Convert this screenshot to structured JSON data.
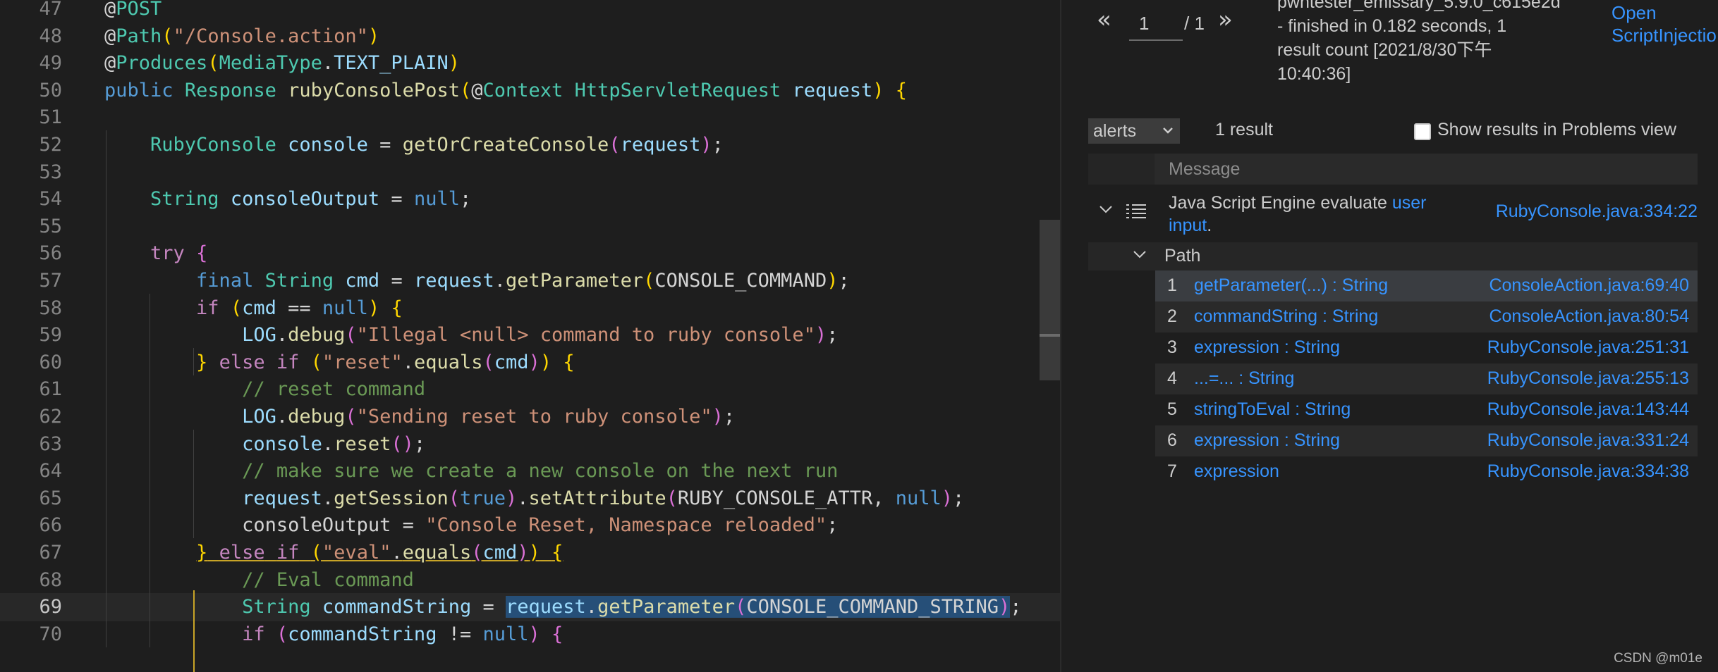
{
  "editor": {
    "current_line": 69,
    "lines": [
      {
        "n": "47",
        "tokens": [
          {
            "t": "@",
            "c": "at"
          },
          {
            "t": "POST",
            "c": "anno"
          }
        ]
      },
      {
        "n": "48",
        "tokens": [
          {
            "t": "@",
            "c": "at"
          },
          {
            "t": "Path",
            "c": "anno"
          },
          {
            "t": "(",
            "c": "bracket-y"
          },
          {
            "t": "\"/Console.action\"",
            "c": "string"
          },
          {
            "t": ")",
            "c": "bracket-y"
          }
        ]
      },
      {
        "n": "49",
        "tokens": [
          {
            "t": "@",
            "c": "at"
          },
          {
            "t": "Produces",
            "c": "anno"
          },
          {
            "t": "(",
            "c": "bracket-y"
          },
          {
            "t": "MediaType",
            "c": "type"
          },
          {
            "t": ".",
            "c": "plain"
          },
          {
            "t": "TEXT_PLAIN",
            "c": "const"
          },
          {
            "t": ")",
            "c": "bracket-y"
          }
        ]
      },
      {
        "n": "50",
        "indent": -1,
        "tokens": [
          {
            "t": "public",
            "c": "keyword"
          },
          {
            "t": " ",
            "c": "plain"
          },
          {
            "t": "Response",
            "c": "type"
          },
          {
            "t": " ",
            "c": "plain"
          },
          {
            "t": "rubyConsolePost",
            "c": "func"
          },
          {
            "t": "(",
            "c": "bracket-y"
          },
          {
            "t": "@",
            "c": "at"
          },
          {
            "t": "Context",
            "c": "anno"
          },
          {
            "t": " ",
            "c": "plain"
          },
          {
            "t": "HttpServletRequest",
            "c": "type"
          },
          {
            "t": " ",
            "c": "plain"
          },
          {
            "t": "request",
            "c": "var"
          },
          {
            "t": ")",
            "c": "bracket-y"
          },
          {
            "t": " ",
            "c": "plain"
          },
          {
            "t": "{",
            "c": "bracket-y"
          }
        ]
      },
      {
        "n": "51",
        "tokens": []
      },
      {
        "n": "52",
        "tokens": [
          {
            "t": "    ",
            "c": "plain"
          },
          {
            "t": "RubyConsole",
            "c": "type"
          },
          {
            "t": " ",
            "c": "plain"
          },
          {
            "t": "console",
            "c": "var"
          },
          {
            "t": " = ",
            "c": "plain"
          },
          {
            "t": "getOrCreateConsole",
            "c": "func"
          },
          {
            "t": "(",
            "c": "bracket-p"
          },
          {
            "t": "request",
            "c": "var"
          },
          {
            "t": ")",
            "c": "bracket-p"
          },
          {
            "t": ";",
            "c": "plain"
          }
        ]
      },
      {
        "n": "53",
        "tokens": []
      },
      {
        "n": "54",
        "tokens": [
          {
            "t": "    ",
            "c": "plain"
          },
          {
            "t": "String",
            "c": "type"
          },
          {
            "t": " ",
            "c": "plain"
          },
          {
            "t": "consoleOutput",
            "c": "var"
          },
          {
            "t": " = ",
            "c": "plain"
          },
          {
            "t": "null",
            "c": "keyword"
          },
          {
            "t": ";",
            "c": "plain"
          }
        ]
      },
      {
        "n": "55",
        "tokens": []
      },
      {
        "n": "56",
        "tokens": [
          {
            "t": "    ",
            "c": "plain"
          },
          {
            "t": "try",
            "c": "control"
          },
          {
            "t": " ",
            "c": "plain"
          },
          {
            "t": "{",
            "c": "bracket-p"
          }
        ]
      },
      {
        "n": "57",
        "tokens": [
          {
            "t": "        ",
            "c": "plain"
          },
          {
            "t": "final",
            "c": "keyword"
          },
          {
            "t": " ",
            "c": "plain"
          },
          {
            "t": "String",
            "c": "type"
          },
          {
            "t": " ",
            "c": "plain"
          },
          {
            "t": "cmd",
            "c": "var"
          },
          {
            "t": " = ",
            "c": "plain"
          },
          {
            "t": "request",
            "c": "var"
          },
          {
            "t": ".",
            "c": "plain"
          },
          {
            "t": "getParameter",
            "c": "func"
          },
          {
            "t": "(",
            "c": "bracket-y"
          },
          {
            "t": "CONSOLE_COMMAND",
            "c": "plain"
          },
          {
            "t": ")",
            "c": "bracket-y"
          },
          {
            "t": ";",
            "c": "plain"
          }
        ]
      },
      {
        "n": "58",
        "tokens": [
          {
            "t": "        ",
            "c": "plain"
          },
          {
            "t": "if",
            "c": "control"
          },
          {
            "t": " ",
            "c": "plain"
          },
          {
            "t": "(",
            "c": "bracket-y"
          },
          {
            "t": "cmd",
            "c": "var"
          },
          {
            "t": " == ",
            "c": "plain"
          },
          {
            "t": "null",
            "c": "keyword"
          },
          {
            "t": ")",
            "c": "bracket-y"
          },
          {
            "t": " ",
            "c": "plain"
          },
          {
            "t": "{",
            "c": "bracket-y"
          }
        ]
      },
      {
        "n": "59",
        "tokens": [
          {
            "t": "            ",
            "c": "plain"
          },
          {
            "t": "LOG",
            "c": "const"
          },
          {
            "t": ".",
            "c": "plain"
          },
          {
            "t": "debug",
            "c": "func"
          },
          {
            "t": "(",
            "c": "bracket-p"
          },
          {
            "t": "\"Illegal <null> command to ruby console\"",
            "c": "string"
          },
          {
            "t": ")",
            "c": "bracket-p"
          },
          {
            "t": ";",
            "c": "plain"
          }
        ]
      },
      {
        "n": "60",
        "tokens": [
          {
            "t": "        ",
            "c": "plain"
          },
          {
            "t": "}",
            "c": "bracket-y"
          },
          {
            "t": " ",
            "c": "plain"
          },
          {
            "t": "else",
            "c": "control"
          },
          {
            "t": " ",
            "c": "plain"
          },
          {
            "t": "if",
            "c": "control"
          },
          {
            "t": " ",
            "c": "plain"
          },
          {
            "t": "(",
            "c": "bracket-y"
          },
          {
            "t": "\"reset\"",
            "c": "string"
          },
          {
            "t": ".",
            "c": "plain"
          },
          {
            "t": "equals",
            "c": "func"
          },
          {
            "t": "(",
            "c": "bracket-p"
          },
          {
            "t": "cmd",
            "c": "var"
          },
          {
            "t": ")",
            "c": "bracket-p"
          },
          {
            "t": ")",
            "c": "bracket-y"
          },
          {
            "t": " ",
            "c": "plain"
          },
          {
            "t": "{",
            "c": "bracket-y"
          }
        ]
      },
      {
        "n": "61",
        "tokens": [
          {
            "t": "            ",
            "c": "plain"
          },
          {
            "t": "// reset command",
            "c": "comment"
          }
        ]
      },
      {
        "n": "62",
        "tokens": [
          {
            "t": "            ",
            "c": "plain"
          },
          {
            "t": "LOG",
            "c": "const"
          },
          {
            "t": ".",
            "c": "plain"
          },
          {
            "t": "debug",
            "c": "func"
          },
          {
            "t": "(",
            "c": "bracket-p"
          },
          {
            "t": "\"Sending reset to ruby console\"",
            "c": "string"
          },
          {
            "t": ")",
            "c": "bracket-p"
          },
          {
            "t": ";",
            "c": "plain"
          }
        ]
      },
      {
        "n": "63",
        "tokens": [
          {
            "t": "            ",
            "c": "plain"
          },
          {
            "t": "console",
            "c": "var"
          },
          {
            "t": ".",
            "c": "plain"
          },
          {
            "t": "reset",
            "c": "func"
          },
          {
            "t": "()",
            "c": "bracket-p"
          },
          {
            "t": ";",
            "c": "plain"
          }
        ]
      },
      {
        "n": "64",
        "tokens": [
          {
            "t": "            ",
            "c": "plain"
          },
          {
            "t": "// make sure we create a new console on the next run",
            "c": "comment"
          }
        ]
      },
      {
        "n": "65",
        "tokens": [
          {
            "t": "            ",
            "c": "plain"
          },
          {
            "t": "request",
            "c": "var"
          },
          {
            "t": ".",
            "c": "plain"
          },
          {
            "t": "getSession",
            "c": "func"
          },
          {
            "t": "(",
            "c": "bracket-p"
          },
          {
            "t": "true",
            "c": "keyword"
          },
          {
            "t": ")",
            "c": "bracket-p"
          },
          {
            "t": ".",
            "c": "plain"
          },
          {
            "t": "setAttribute",
            "c": "func"
          },
          {
            "t": "(",
            "c": "bracket-p"
          },
          {
            "t": "RUBY_CONSOLE_ATTR",
            "c": "plain"
          },
          {
            "t": ", ",
            "c": "plain"
          },
          {
            "t": "null",
            "c": "keyword"
          },
          {
            "t": ")",
            "c": "bracket-p"
          },
          {
            "t": ";",
            "c": "plain"
          }
        ]
      },
      {
        "n": "66",
        "tokens": [
          {
            "t": "            ",
            "c": "plain"
          },
          {
            "t": "consoleOutput",
            "c": "plain"
          },
          {
            "t": " = ",
            "c": "plain"
          },
          {
            "t": "\"Console Reset, Namespace reloaded\"",
            "c": "string"
          },
          {
            "t": ";",
            "c": "plain"
          }
        ]
      },
      {
        "n": "67",
        "tokens": [
          {
            "t": "        ",
            "c": "plain"
          },
          {
            "t": "}",
            "c": "bracket-y under"
          },
          {
            "t": " ",
            "c": "plain under"
          },
          {
            "t": "else",
            "c": "control under"
          },
          {
            "t": " ",
            "c": "plain under"
          },
          {
            "t": "if",
            "c": "control under"
          },
          {
            "t": " ",
            "c": "plain under"
          },
          {
            "t": "(",
            "c": "bracket-y under"
          },
          {
            "t": "\"eval\"",
            "c": "string under"
          },
          {
            "t": ".",
            "c": "plain under"
          },
          {
            "t": "equals",
            "c": "func under"
          },
          {
            "t": "(",
            "c": "bracket-p under"
          },
          {
            "t": "cmd",
            "c": "var under"
          },
          {
            "t": ")",
            "c": "bracket-p under"
          },
          {
            "t": ")",
            "c": "bracket-y under"
          },
          {
            "t": " ",
            "c": "plain under"
          },
          {
            "t": "{",
            "c": "bracket-y under"
          }
        ]
      },
      {
        "n": "68",
        "tokens": [
          {
            "t": "            ",
            "c": "plain"
          },
          {
            "t": "// Eval command",
            "c": "comment"
          }
        ]
      },
      {
        "n": "69",
        "tokens": [
          {
            "t": "            ",
            "c": "plain"
          },
          {
            "t": "String",
            "c": "type"
          },
          {
            "t": " ",
            "c": "plain"
          },
          {
            "t": "commandString",
            "c": "var"
          },
          {
            "t": " = ",
            "c": "plain"
          },
          {
            "t": "request",
            "c": "var sel"
          },
          {
            "t": ".",
            "c": "plain sel"
          },
          {
            "t": "getParameter",
            "c": "func sel"
          },
          {
            "t": "(",
            "c": "bracket-p sel"
          },
          {
            "t": "CONSOLE_COMMAND_STRING",
            "c": "plain sel"
          },
          {
            "t": ")",
            "c": "bracket-p sel"
          },
          {
            "t": ";",
            "c": "plain"
          }
        ]
      },
      {
        "n": "70",
        "tokens": [
          {
            "t": "            ",
            "c": "plain"
          },
          {
            "t": "if",
            "c": "control"
          },
          {
            "t": " ",
            "c": "plain"
          },
          {
            "t": "(",
            "c": "bracket-p"
          },
          {
            "t": "commandString",
            "c": "var"
          },
          {
            "t": " != ",
            "c": "plain"
          },
          {
            "t": "null",
            "c": "keyword"
          },
          {
            "t": ")",
            "c": "bracket-p"
          },
          {
            "t": " ",
            "c": "plain"
          },
          {
            "t": "{",
            "c": "bracket-p"
          }
        ]
      }
    ]
  },
  "results": {
    "pagination": {
      "prev_icon": "«",
      "page": "1",
      "total": "/ 1",
      "next_icon": "»"
    },
    "status_lines": [
      "pwntester_emissary_5.9.0_c615e2d",
      "- finished in 0.182 seconds, 1",
      "result count [2021/8/30下午",
      "10:40:36]"
    ],
    "open_link_lines": [
      "Open",
      "ScriptInjectio"
    ],
    "query_select": "alerts",
    "result_count": "1 result",
    "problems_checkbox_label": "Show results in Problems view",
    "problems_checked": false,
    "column_header": "Message",
    "alert": {
      "message_prefix": "Java Script Engine evaluate ",
      "message_link": "user input",
      "message_suffix": ".",
      "location": "RubyConsole.java:334:22"
    },
    "path_label": "Path",
    "selected_step": 1,
    "steps": [
      {
        "num": "1",
        "label": "getParameter(...) : String",
        "location": "ConsoleAction.java:69:40"
      },
      {
        "num": "2",
        "label": "commandString : String",
        "location": "ConsoleAction.java:80:54"
      },
      {
        "num": "3",
        "label": "expression : String",
        "location": "RubyConsole.java:251:31"
      },
      {
        "num": "4",
        "label": "...=... : String",
        "location": "RubyConsole.java:255:13"
      },
      {
        "num": "5",
        "label": "stringToEval : String",
        "location": "RubyConsole.java:143:44"
      },
      {
        "num": "6",
        "label": "expression : String",
        "location": "RubyConsole.java:331:24"
      },
      {
        "num": "7",
        "label": "expression",
        "location": "RubyConsole.java:334:38"
      }
    ]
  },
  "watermark": "CSDN @m01e",
  "colors": {
    "link": "#3794ff",
    "selected_row": "#3a3d41",
    "alt_row": "#2a2a2a",
    "selection": "#264f78"
  }
}
